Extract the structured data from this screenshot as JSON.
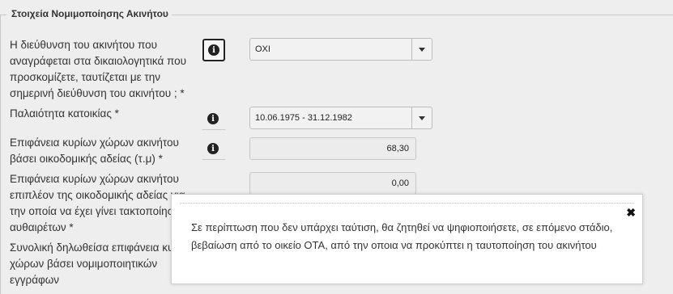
{
  "section": {
    "legend": "Στοιχεία Νομιμοποίησης Ακινήτου"
  },
  "fields": [
    {
      "label": "Η διεύθυνση του ακινήτου που αναγράφεται στα δικαιολογητικά που προσκομίζετε, ταυτίζεται με την σημερινή διεύθυνση του ακινήτου ; *",
      "value": "ΟΧΙ"
    },
    {
      "label": "Παλαιότητα κατοικίας *",
      "value": "10.06.1975 - 31.12.1982"
    },
    {
      "label": "Επιφάνεια κυρίων χώρων ακινήτου βάσει οικοδομικής αδείας (τ.μ) *",
      "value": "68,30"
    },
    {
      "label": "Επιφάνεια κυρίων χώρων ακινήτου επιπλέον της οικοδομικής αδείας για την οποία να έχει γίνει τακτοποίηση αυθαιρέτων *",
      "value": "0,00"
    },
    {
      "label": "Συνολική δηλωθείσα επιφάνεια κυρίων χώρων βάσει νομιμοποιητικών εγγράφων"
    }
  ],
  "icons": {
    "info": "info-icon",
    "close": "close-icon",
    "dropdown": "chevron-down-icon"
  },
  "popup": {
    "close_glyph": "✖",
    "message": "Σε περίπτωση που δεν υπάρχει ταύτιση, θα ζητηθεί να ψηφιοποιήσετε, σε επόμενο στάδιο, βεβαίωση από το οικείο ΟΤΑ, από την οποια να προκύπτει η ταυτοποίηση του ακινήτου"
  }
}
